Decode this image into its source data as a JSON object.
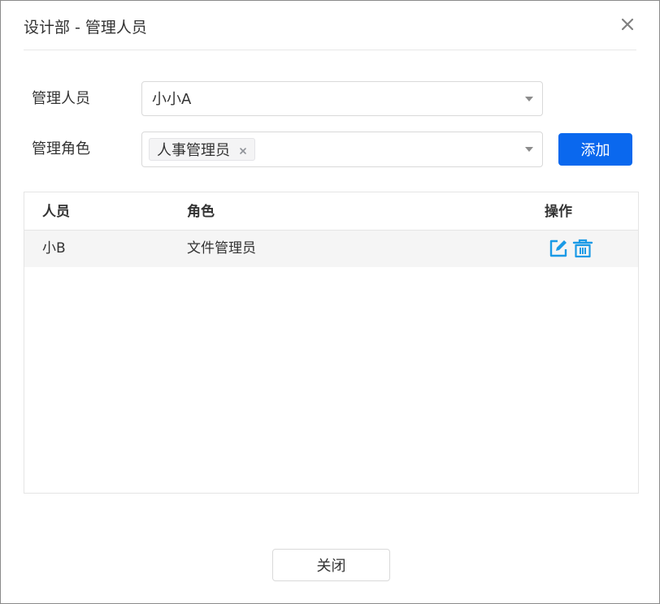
{
  "dialog": {
    "title": "设计部 - 管理人员",
    "close_icon": "close-icon"
  },
  "form": {
    "manager": {
      "label": "管理人员",
      "value": "小小A"
    },
    "role": {
      "label": "管理角色",
      "tags": [
        "人事管理员"
      ]
    },
    "add_label": "添加"
  },
  "table": {
    "columns": [
      "人员",
      "角色",
      "操作"
    ],
    "rows": [
      {
        "person": "小B",
        "role": "文件管理员",
        "actions": [
          "edit-icon",
          "delete-icon"
        ]
      }
    ]
  },
  "footer": {
    "close_label": "关闭"
  },
  "colors": {
    "primary": "#0a68ee",
    "icon_accent": "#1a9ae6"
  }
}
